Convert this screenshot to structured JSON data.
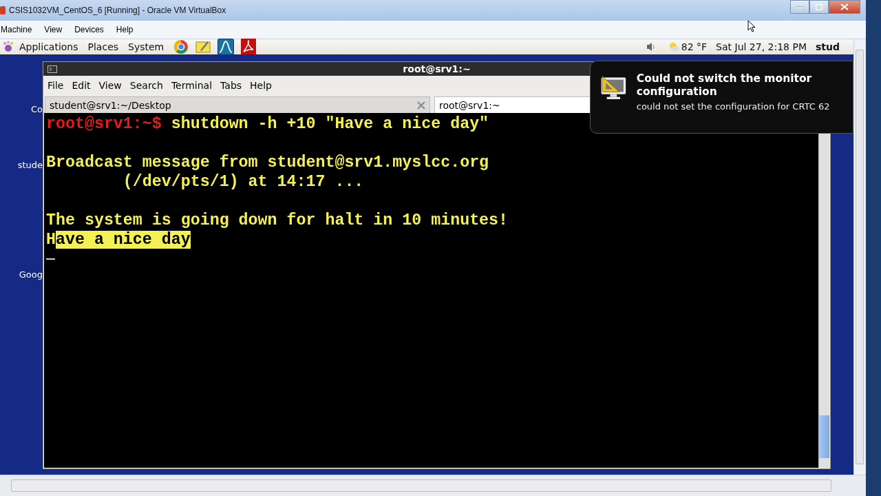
{
  "window": {
    "title": "CSIS1032VM_CentOS_6 [Running] - Oracle VM VirtualBox"
  },
  "menu": [
    "Machine",
    "View",
    "Devices",
    "Help"
  ],
  "panel": {
    "menus": [
      "Applications",
      "Places",
      "System"
    ],
    "temperature": "82 °F",
    "clock": "Sat Jul 27,  2:18 PM",
    "user": "stud"
  },
  "desktop_icons": [
    {
      "label": "Co"
    },
    {
      "label": "stude"
    },
    {
      "label": "Goog"
    }
  ],
  "terminal": {
    "title": "root@srv1:~",
    "menu": [
      "File",
      "Edit",
      "View",
      "Search",
      "Terminal",
      "Tabs",
      "Help"
    ],
    "tabs": [
      {
        "label": "student@srv1:~/Desktop",
        "selected": false
      },
      {
        "label": "root@srv1:~",
        "selected": true
      }
    ],
    "lines": [
      {
        "kind": "prompt",
        "prompt": "root@srv1:~$",
        "text": " shutdown -h +10 \"Have a nice day\""
      },
      {
        "kind": "blank"
      },
      {
        "kind": "output",
        "text": "Broadcast message from student@srv1.myslcc.org"
      },
      {
        "kind": "output",
        "text": "        (/dev/pts/1) at 14:17 ..."
      },
      {
        "kind": "blank"
      },
      {
        "kind": "output",
        "text": "The system is going down for halt in 10 minutes!"
      },
      {
        "kind": "highlight",
        "text": "H",
        "highlighted": "ave a nice day"
      },
      {
        "kind": "cursor"
      }
    ]
  },
  "notification": {
    "title": "Could not switch the monitor configuration",
    "body": "could not set the configuration for CRTC 62"
  }
}
